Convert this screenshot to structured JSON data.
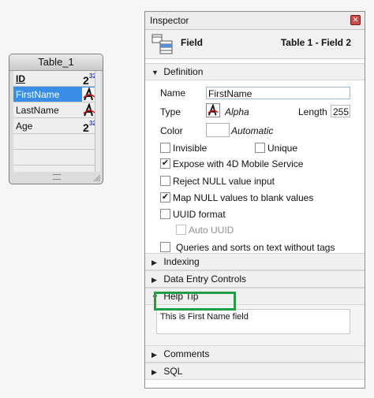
{
  "table_widget": {
    "title": "Table_1",
    "fields": [
      {
        "name": "ID",
        "type_icon": "longint-icon",
        "primary_key": true,
        "selected": false
      },
      {
        "name": "FirstName",
        "type_icon": "alpha-icon",
        "primary_key": false,
        "selected": true
      },
      {
        "name": "LastName",
        "type_icon": "alpha-icon",
        "primary_key": false,
        "selected": false
      },
      {
        "name": "Age",
        "type_icon": "longint-icon",
        "primary_key": false,
        "selected": false
      }
    ]
  },
  "inspector": {
    "title": "Inspector",
    "header": {
      "label": "Field",
      "context": "Table 1 - Field 2"
    },
    "definition": {
      "section_label": "Definition",
      "name_label": "Name",
      "name_value": "FirstName",
      "type_label": "Type",
      "type_value": "Alpha",
      "length_label": "Length",
      "length_value": "255",
      "color_label": "Color",
      "color_value": "Automatic",
      "options": {
        "invisible": {
          "label": "Invisible",
          "checked": false
        },
        "unique": {
          "label": "Unique",
          "checked": false
        },
        "expose_4d_mobile": {
          "label": "Expose with 4D Mobile Service",
          "checked": true
        },
        "reject_null": {
          "label": "Reject NULL value input",
          "checked": false
        },
        "map_null": {
          "label": "Map NULL values to blank values",
          "checked": true
        },
        "uuid_format": {
          "label": "UUID format",
          "checked": false
        },
        "auto_uuid": {
          "label": "Auto UUID",
          "checked": false,
          "disabled": true
        },
        "queries_no_tags": {
          "label": "Queries and sorts on text without tags",
          "checked": false
        }
      }
    },
    "sections": {
      "indexing": "Indexing",
      "data_entry": "Data Entry Controls",
      "help_tip": "Help Tip",
      "comments": "Comments",
      "sql": "SQL"
    },
    "help_tip_text": "This is First Name field",
    "highlight_color": "#1f9e46"
  }
}
